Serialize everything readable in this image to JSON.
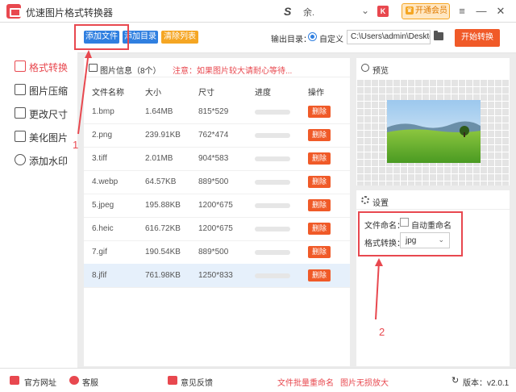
{
  "app": {
    "title": "优速图片格式转换器"
  },
  "titlebar": {
    "user_name": "余.",
    "badge": "K",
    "vip_label": "开通会员",
    "chevron": "⌄",
    "minimize": "—",
    "maximize": "☐",
    "close": "✕"
  },
  "sidebar": {
    "items": [
      {
        "label": "格式转换",
        "active": true
      },
      {
        "label": "图片压缩",
        "active": false
      },
      {
        "label": "更改尺寸",
        "active": false
      },
      {
        "label": "美化图片",
        "active": false
      },
      {
        "label": "添加水印",
        "active": false
      }
    ]
  },
  "toolbar": {
    "add_file": "添加文件",
    "add_dir": "添加目录",
    "clear_list": "清除列表",
    "output_label": "输出目录：",
    "custom_label": "自定义",
    "output_path": "C:\\Users\\admin\\Deskto",
    "start": "开始转换"
  },
  "info": {
    "title": "图片信息（8个）",
    "note": "注意：如果图片较大请耐心等待..."
  },
  "table": {
    "headers": [
      "文件名称",
      "大小",
      "尺寸",
      "进度",
      "操作"
    ],
    "rows": [
      {
        "name": "1.bmp",
        "size": "1.64MB",
        "dim": "815*529",
        "progress": 0,
        "action": "删除"
      },
      {
        "name": "2.png",
        "size": "239.91KB",
        "dim": "762*474",
        "progress": 0,
        "action": "删除"
      },
      {
        "name": "3.tiff",
        "size": "2.01MB",
        "dim": "904*583",
        "progress": 0,
        "action": "删除"
      },
      {
        "name": "4.webp",
        "size": "64.57KB",
        "dim": "889*500",
        "progress": 0,
        "action": "删除"
      },
      {
        "name": "5.jpeg",
        "size": "195.88KB",
        "dim": "1200*675",
        "progress": 0,
        "action": "删除"
      },
      {
        "name": "6.heic",
        "size": "616.72KB",
        "dim": "1200*675",
        "progress": 0,
        "action": "删除"
      },
      {
        "name": "7.gif",
        "size": "190.54KB",
        "dim": "889*500",
        "progress": 0,
        "action": "删除"
      },
      {
        "name": "8.jfif",
        "size": "761.98KB",
        "dim": "1250*833",
        "progress": 0,
        "action": "删除"
      }
    ]
  },
  "preview": {
    "title": "预览"
  },
  "settings": {
    "title": "设置",
    "naming_label": "文件命名：",
    "auto_rename": "自动重命名",
    "auto_rename_checked": false,
    "format_label": "格式转换：",
    "format_value": "jpg"
  },
  "annotations": {
    "one": "1",
    "two": "2"
  },
  "footer": {
    "website": "官方网址",
    "support": "客服",
    "feedback": "意见反馈",
    "batch_rename": "文件批量重命名",
    "lossless_enlarge": "图片无损放大",
    "version": "版本：v2.0.1"
  },
  "colors": {
    "accent": "#e8484f",
    "blue": "#2f7fe0",
    "orange": "#f05a28",
    "yellow": "#f5a623"
  }
}
